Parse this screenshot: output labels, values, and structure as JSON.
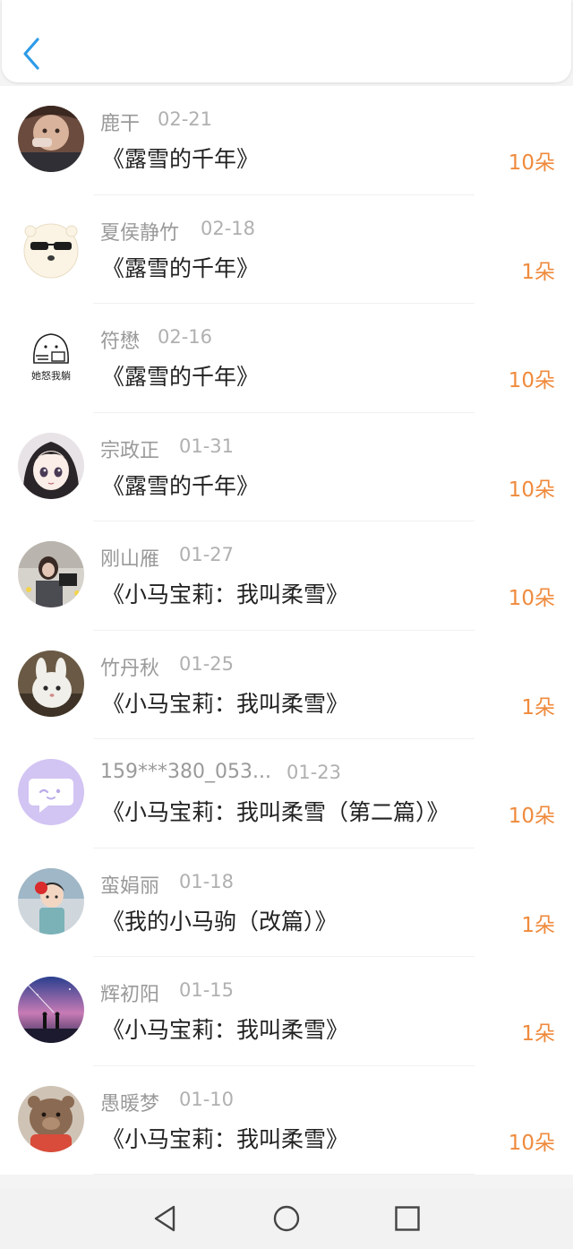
{
  "header": {
    "back_icon": "chevron-left-icon"
  },
  "colors": {
    "accent": "#2d9be8",
    "amount": "#ef8a3c",
    "name": "#9a9a9a",
    "title": "#222222"
  },
  "entries": [
    {
      "name": "鹿干",
      "date": "02-21",
      "title": "《露雪的千年》",
      "amount": "10朵"
    },
    {
      "name": "夏侯静竹",
      "date": "02-18",
      "title": "《露雪的千年》",
      "amount": "1朵"
    },
    {
      "name": "符懋",
      "date": "02-16",
      "title": "《露雪的千年》",
      "amount": "10朵"
    },
    {
      "name": "宗政正",
      "date": "01-31",
      "title": "《露雪的千年》",
      "amount": "10朵"
    },
    {
      "name": "刚山雁",
      "date": "01-27",
      "title": "《小马宝莉：我叫柔雪》",
      "amount": "10朵"
    },
    {
      "name": "竹丹秋",
      "date": "01-25",
      "title": "《小马宝莉：我叫柔雪》",
      "amount": "1朵"
    },
    {
      "name": "159***380_053...",
      "date": "01-23",
      "title": "《小马宝莉：我叫柔雪（第二篇）》",
      "amount": "10朵"
    },
    {
      "name": "蛮娟丽",
      "date": "01-18",
      "title": "《我的小马驹（改篇）》",
      "amount": "1朵"
    },
    {
      "name": "辉初阳",
      "date": "01-15",
      "title": "《小马宝莉：我叫柔雪》",
      "amount": "1朵"
    },
    {
      "name": "愚暖梦",
      "date": "01-10",
      "title": "《小马宝莉：我叫柔雪》",
      "amount": "10朵"
    }
  ],
  "avatar_text": "她怒我躺",
  "navbar": {
    "back": "triangle-back-icon",
    "home": "circle-home-icon",
    "recents": "square-recents-icon"
  }
}
